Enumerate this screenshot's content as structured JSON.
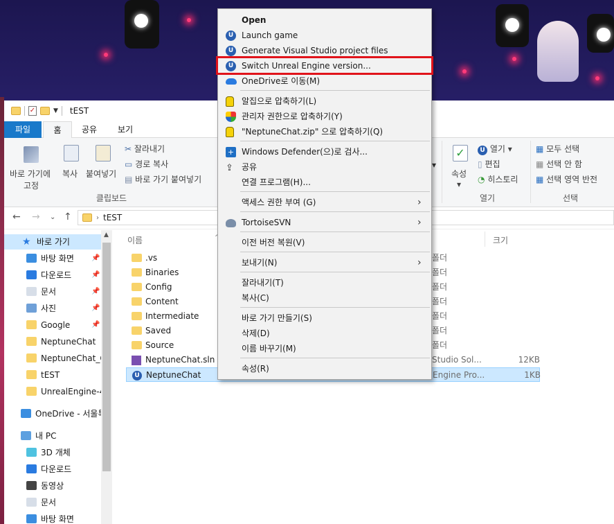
{
  "window": {
    "title": "tEST"
  },
  "ribbon_tabs": [
    "파일",
    "홈",
    "공유",
    "보기"
  ],
  "ribbon": {
    "pin_quick": "바로 가기에",
    "pin_quick2": "고정",
    "copy": "복사",
    "paste": "붙여넣기",
    "cut": "잘라내기",
    "copy_path": "경로 복사",
    "paste_shortcut": "바로 가기 붙여넣기",
    "clipboard_group": "클립보드",
    "properties": "속성",
    "open": "열기",
    "edit": "편집",
    "history": "히스토리",
    "open_group": "열기",
    "select_all": "모두 선택",
    "select_none": "선택 안 함",
    "invert": "선택 영역 반전",
    "select_group": "선택"
  },
  "address": {
    "path": "tEST"
  },
  "sidebar": [
    {
      "label": "바로 가기",
      "icon": "star-icon",
      "pin": false
    },
    {
      "label": "바탕 화면",
      "icon": "desktop-icon",
      "pin": true
    },
    {
      "label": "다운로드",
      "icon": "download-icon",
      "pin": true
    },
    {
      "label": "문서",
      "icon": "document-icon",
      "pin": true
    },
    {
      "label": "사진",
      "icon": "pictures-icon",
      "pin": true
    },
    {
      "label": "Google",
      "icon": "folder-icon",
      "pin": true
    },
    {
      "label": "NeptuneChat",
      "icon": "folder-icon",
      "pin": false
    },
    {
      "label": "NeptuneChat_O",
      "icon": "folder-icon",
      "pin": false
    },
    {
      "label": "tEST",
      "icon": "folder-icon",
      "pin": false
    },
    {
      "label": "UnrealEngine-4.",
      "icon": "folder-icon",
      "pin": false
    },
    {
      "label": "OneDrive - 서울특",
      "icon": "onedrive-icon",
      "pin": false
    },
    {
      "label": "내 PC",
      "icon": "pc-icon",
      "pin": false
    },
    {
      "label": "3D 개체",
      "icon": "3d-objects-icon",
      "pin": false
    },
    {
      "label": "다운로드",
      "icon": "download-icon",
      "pin": false
    },
    {
      "label": "동영상",
      "icon": "video-icon",
      "pin": false
    },
    {
      "label": "문서",
      "icon": "document-icon",
      "pin": false
    },
    {
      "label": "바탕 화면",
      "icon": "desktop-icon",
      "pin": false
    }
  ],
  "columns": {
    "name": "이름",
    "size": "크기"
  },
  "files": [
    {
      "name": ".vs",
      "type": "폴더",
      "size": ""
    },
    {
      "name": "Binaries",
      "type": "폴더",
      "size": ""
    },
    {
      "name": "Config",
      "type": "폴더",
      "size": ""
    },
    {
      "name": "Content",
      "type": "폴더",
      "size": ""
    },
    {
      "name": "Intermediate",
      "type": "폴더",
      "size": ""
    },
    {
      "name": "Saved",
      "type": "폴더",
      "size": ""
    },
    {
      "name": "Source",
      "type": "폴더",
      "size": ""
    },
    {
      "name": "NeptuneChat.sln",
      "type": "Studio Sol...",
      "size": "12KB"
    },
    {
      "name": "NeptuneChat",
      "type": "Engine Pro...",
      "size": "1KB"
    }
  ],
  "context_menu": {
    "open": "Open",
    "launch": "Launch game",
    "generate": "Generate Visual Studio project files",
    "switch": "Switch Unreal Engine version...",
    "onedrive": "OneDrive로 이동(M)",
    "zip_alzip": "알집으로 압축하기(L)",
    "zip_admin": "관리자 권한으로 압축하기(Y)",
    "zip_named": "\"NeptuneChat.zip\" 으로 압축하기(Q)",
    "defender": "Windows Defender(으)로 검사...",
    "share": "공유",
    "open_with": "연결 프로그램(H)...",
    "access": "액세스 권한 부여 (G)",
    "tortoise": "TortoiseSVN",
    "restore": "이전 버전 복원(V)",
    "send_to": "보내기(N)",
    "cut": "잘라내기(T)",
    "copy": "복사(C)",
    "shortcut": "바로 가기 만들기(S)",
    "delete": "삭제(D)",
    "rename": "이름 바꾸기(M)",
    "properties": "속성(R)"
  },
  "colors": {
    "accent": "#1979ca",
    "selection": "#cce8ff",
    "highlight_box": "#e1131a"
  }
}
